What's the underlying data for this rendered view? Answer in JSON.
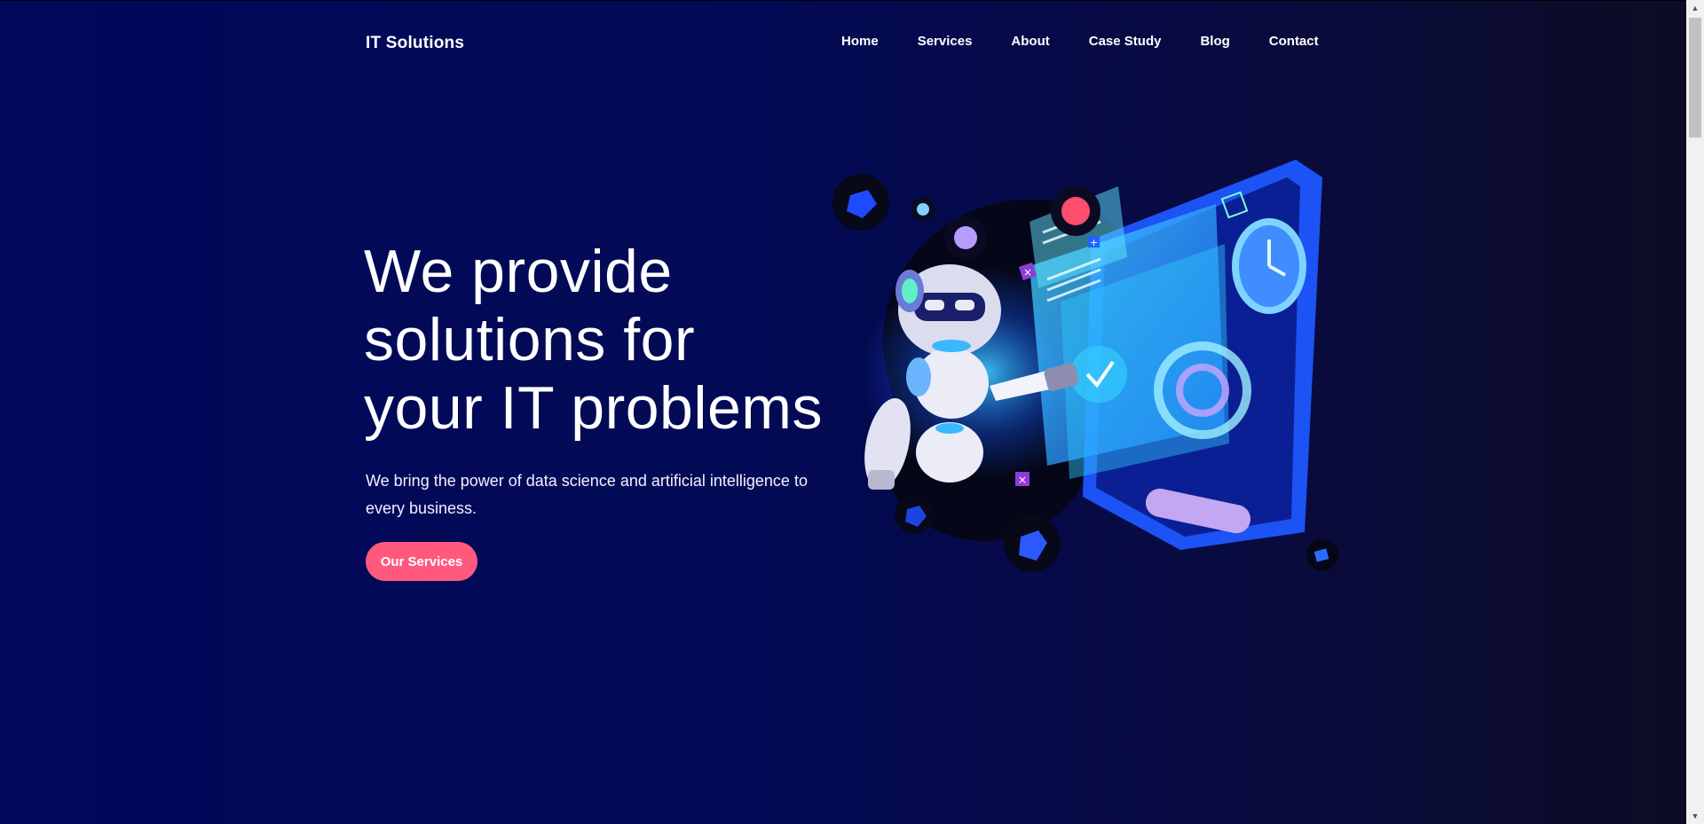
{
  "brand": {
    "name": "IT Solutions"
  },
  "nav": {
    "items": [
      {
        "label": "Home"
      },
      {
        "label": "Services"
      },
      {
        "label": "About"
      },
      {
        "label": "Case Study"
      },
      {
        "label": "Blog"
      },
      {
        "label": "Contact"
      }
    ]
  },
  "hero": {
    "title": "We provide solutions for your IT problems",
    "subtitle": "We bring the power of data science and artificial intelligence to every business.",
    "cta_label": "Our Services"
  },
  "illustration": {
    "icon": "robot-with-dashboard-illustration"
  },
  "colors": {
    "background": "#02085a",
    "cta": "#ff5a7e",
    "accent_cyan": "#34d9ff",
    "accent_blue": "#1e63ff",
    "accent_purple": "#b49cf5"
  }
}
